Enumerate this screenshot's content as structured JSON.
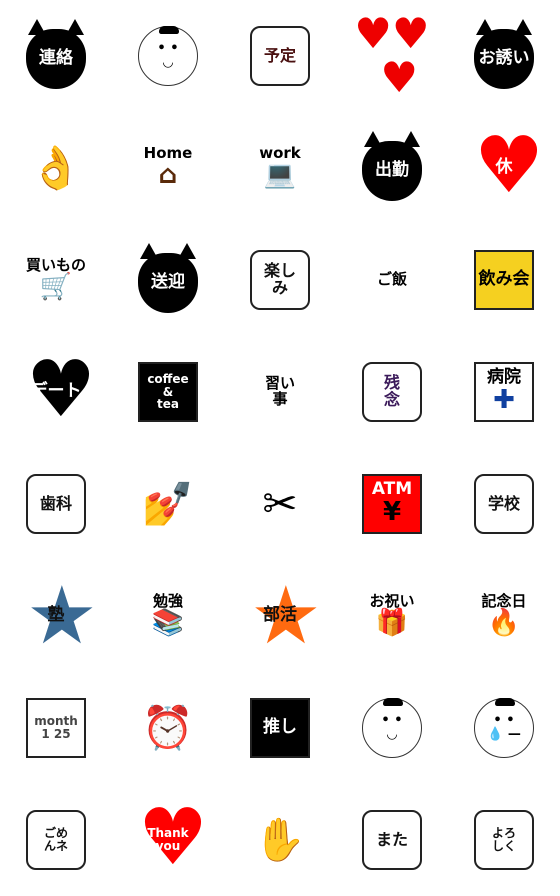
{
  "stickers": [
    {
      "text": "連絡",
      "shape": "cat",
      "icon": "cat-flower-icon"
    },
    {
      "text": "",
      "shape": "face",
      "icon": "smiling-face-icon",
      "glyph": "• •\n◡"
    },
    {
      "text": "予定",
      "shape": "bubble",
      "icon": "speech-bubble-icon",
      "t": "#4a1010"
    },
    {
      "text": "",
      "shape": "plain",
      "icon": "hearts-icon",
      "glyph": "♥♥\n ♥",
      "t": "#e00"
    },
    {
      "text": "お誘い",
      "shape": "cat",
      "icon": "cat-flower-icon"
    },
    {
      "text": "",
      "shape": "icon",
      "icon": "ok-hand-icon",
      "glyph": "👌",
      "t": "#000"
    },
    {
      "text": "Home",
      "shape": "plain",
      "icon": "house-icon",
      "glyph": "⌂",
      "t": "#000",
      "gc": "#5a2a0a"
    },
    {
      "text": "work",
      "shape": "plain",
      "icon": "laptop-icon",
      "glyph": "💻",
      "t": "#000"
    },
    {
      "text": "出勤",
      "shape": "cat",
      "icon": "cat-icon"
    },
    {
      "text": "休",
      "shape": "heart",
      "c": "#f00",
      "icon": "heart-icon"
    },
    {
      "text": "買いもの",
      "shape": "plain",
      "icon": "shopping-cart-icon",
      "glyph": "🛒",
      "t": "#000",
      "gc": "#2a2"
    },
    {
      "text": "送迎",
      "shape": "cat",
      "icon": "cat-heart-icon"
    },
    {
      "text": "楽し\nみ",
      "shape": "bubble",
      "icon": "speech-bubble-icon"
    },
    {
      "text": "ご飯",
      "shape": "plain",
      "icon": "rice-bowl-icon",
      "t": "#000"
    },
    {
      "text": "飲み会",
      "shape": "box",
      "c": "#f5d020",
      "t": "#000",
      "icon": "beer-mug-icon"
    },
    {
      "text": "デート",
      "shape": "heart",
      "c": "#000",
      "icon": "heart-icon"
    },
    {
      "text": "coffee\n&\ntea",
      "shape": "box",
      "c": "#000",
      "t": "#fff",
      "icon": "coffee-mug-icon"
    },
    {
      "text": "習い\n事",
      "shape": "plain",
      "icon": "flower-icon",
      "t": "#000"
    },
    {
      "text": "残\n念",
      "shape": "bubble",
      "t": "#3b1a5a",
      "icon": "broken-heart-icon"
    },
    {
      "text": "病院",
      "shape": "box",
      "c": "#fff",
      "t": "#000",
      "icon": "hospital-sign-icon",
      "glyph": "✚",
      "gc": "#1040a0"
    },
    {
      "text": "歯科",
      "shape": "bubble",
      "icon": "tooth-icon"
    },
    {
      "text": "",
      "shape": "icon",
      "icon": "nail-polish-icon",
      "glyph": "💅",
      "t": "#d4d"
    },
    {
      "text": "",
      "shape": "icon",
      "icon": "scissors-barber-pole-icon",
      "glyph": "✂",
      "t": "#000"
    },
    {
      "text": "ATM",
      "shape": "box",
      "c": "#f00",
      "t": "#fff",
      "icon": "atm-icon",
      "glyph": "¥",
      "gc": "#000"
    },
    {
      "text": "学校",
      "shape": "bubble",
      "icon": "school-tag-icon"
    },
    {
      "text": "塾",
      "shape": "star",
      "c": "#3a6a94",
      "icon": "star-cat-icon"
    },
    {
      "text": "勉強",
      "shape": "plain",
      "icon": "books-icon",
      "glyph": "📚",
      "t": "#000"
    },
    {
      "text": "部活",
      "shape": "star",
      "c": "#ff6a10",
      "icon": "star-cat-icon"
    },
    {
      "text": "お祝い",
      "shape": "plain",
      "icon": "gift-icon",
      "glyph": "🎁",
      "t": "#000"
    },
    {
      "text": "記念日",
      "shape": "plain",
      "icon": "candle-icon",
      "glyph": "🔥",
      "t": "#000"
    },
    {
      "text": "month\n1  25",
      "shape": "box",
      "c": "#fff",
      "t": "#444",
      "icon": "calendar-icon"
    },
    {
      "text": "",
      "shape": "icon",
      "icon": "alarm-clock-icon",
      "glyph": "⏰",
      "t": "#1a5a8a"
    },
    {
      "text": "推し",
      "shape": "box",
      "c": "#000",
      "t": "#fff",
      "icon": "speech-bubble-heart-icon"
    },
    {
      "text": "",
      "shape": "face",
      "icon": "smiling-face-icon",
      "glyph": "• •\n◡"
    },
    {
      "text": "",
      "shape": "face",
      "icon": "crying-face-icon",
      "glyph": "• •\n💧 —"
    },
    {
      "text": "ごめ\nんネ",
      "shape": "bubble",
      "icon": "cat-bubble-icon"
    },
    {
      "text": "Thank\nyou",
      "shape": "heart",
      "c": "#f00",
      "icon": "heart-icon"
    },
    {
      "text": "",
      "shape": "icon",
      "icon": "waving-hand-icon",
      "glyph": "✋",
      "t": "#000"
    },
    {
      "text": "また",
      "shape": "bubble",
      "icon": "cat-bubble-icon"
    },
    {
      "text": "よろ\nしく",
      "shape": "bubble",
      "icon": "speech-bubble-icon"
    }
  ]
}
